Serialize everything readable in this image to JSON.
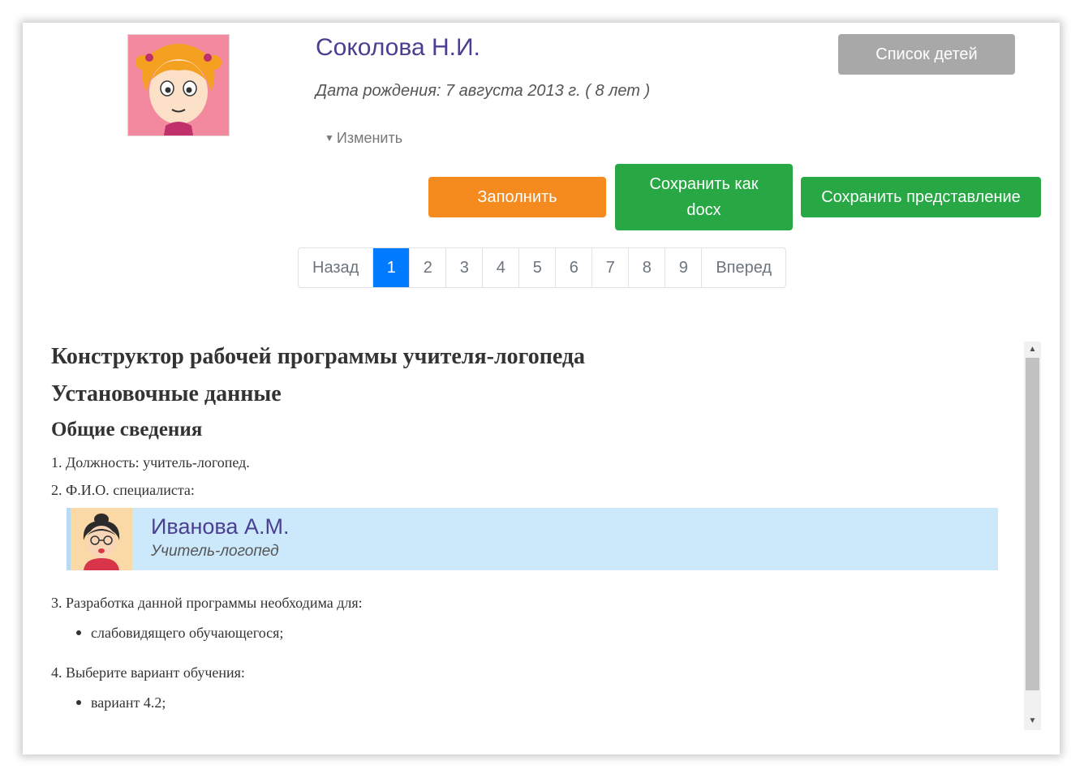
{
  "header": {
    "child_name": "Соколова Н.И.",
    "birth_info": "Дата рождения: 7 августа 2013 г. ( 8 лет )",
    "edit_link": "Изменить",
    "children_list_button": "Список детей"
  },
  "actions": {
    "fill": "Заполнить",
    "save_docx": "Сохранить как docx",
    "save_view": "Сохранить представление"
  },
  "pagination": {
    "prev": "Назад",
    "pages": [
      "1",
      "2",
      "3",
      "4",
      "5",
      "6",
      "7",
      "8",
      "9"
    ],
    "active_page": "1",
    "next": "Вперед"
  },
  "document": {
    "title": "Конструктор рабочей программы учителя-логопеда",
    "section": "Установочные данные",
    "subsection": "Общие сведения",
    "item1": "1. Должность: учитель-логопед.",
    "item2": "2. Ф.И.О. специалиста:",
    "specialist": {
      "name": "Иванова А.М.",
      "role": "Учитель-логопед"
    },
    "item3": "3. Разработка данной программы необходима для:",
    "item3_bullet": "слабовидящего обучающегося;",
    "item4": "4. Выберите вариант обучения:",
    "item4_bullet": "вариант 4.2;"
  },
  "colors": {
    "accent_purple": "#4a3f91",
    "orange": "#f58a1f",
    "green": "#27a844",
    "gray_button": "#a8a8a8",
    "active_page": "#007bff",
    "specialist_bg": "#cce9fc"
  }
}
